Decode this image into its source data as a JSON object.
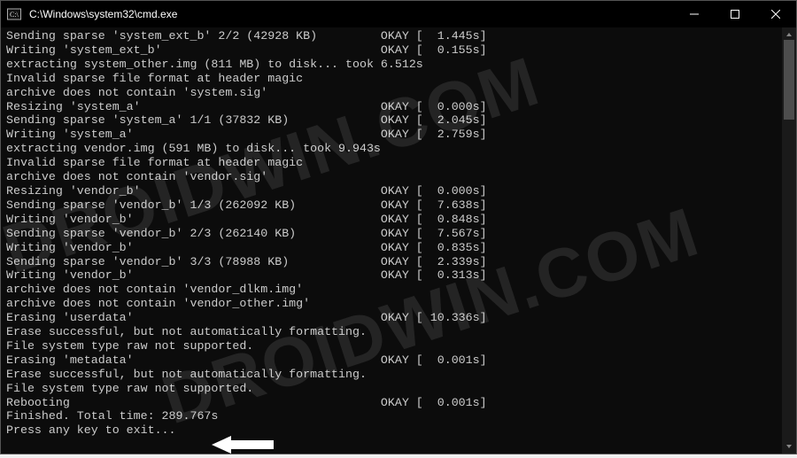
{
  "window": {
    "title": "C:\\Windows\\system32\\cmd.exe"
  },
  "watermark": "DROIDWIN.COM",
  "terminal": [
    {
      "text": "Sending sparse 'system_ext_b' 2/2 (42928 KB)",
      "status": "OKAY",
      "time": "1.445s"
    },
    {
      "text": "Writing 'system_ext_b'",
      "status": "OKAY",
      "time": "0.155s"
    },
    {
      "text": "extracting system_other.img (811 MB) to disk... took 6.512s"
    },
    {
      "text": "Invalid sparse file format at header magic"
    },
    {
      "text": "archive does not contain 'system.sig'"
    },
    {
      "text": "Resizing 'system_a'",
      "status": "OKAY",
      "time": "0.000s"
    },
    {
      "text": "Sending sparse 'system_a' 1/1 (37832 KB)",
      "status": "OKAY",
      "time": "2.045s"
    },
    {
      "text": "Writing 'system_a'",
      "status": "OKAY",
      "time": "2.759s"
    },
    {
      "text": "extracting vendor.img (591 MB) to disk... took 9.943s"
    },
    {
      "text": "Invalid sparse file format at header magic"
    },
    {
      "text": "archive does not contain 'vendor.sig'"
    },
    {
      "text": "Resizing 'vendor_b'",
      "status": "OKAY",
      "time": "0.000s"
    },
    {
      "text": "Sending sparse 'vendor_b' 1/3 (262092 KB)",
      "status": "OKAY",
      "time": "7.638s"
    },
    {
      "text": "Writing 'vendor_b'",
      "status": "OKAY",
      "time": "0.848s"
    },
    {
      "text": "Sending sparse 'vendor_b' 2/3 (262140 KB)",
      "status": "OKAY",
      "time": "7.567s"
    },
    {
      "text": "Writing 'vendor_b'",
      "status": "OKAY",
      "time": "0.835s"
    },
    {
      "text": "Sending sparse 'vendor_b' 3/3 (78988 KB)",
      "status": "OKAY",
      "time": "2.339s"
    },
    {
      "text": "Writing 'vendor_b'",
      "status": "OKAY",
      "time": "0.313s"
    },
    {
      "text": "archive does not contain 'vendor_dlkm.img'"
    },
    {
      "text": "archive does not contain 'vendor_other.img'"
    },
    {
      "text": "Erasing 'userdata'",
      "status": "OKAY",
      "time": "10.336s"
    },
    {
      "text": "Erase successful, but not automatically formatting."
    },
    {
      "text": "File system type raw not supported."
    },
    {
      "text": "Erasing 'metadata'",
      "status": "OKAY",
      "time": "0.001s"
    },
    {
      "text": "Erase successful, but not automatically formatting."
    },
    {
      "text": "File system type raw not supported."
    },
    {
      "text": "Rebooting",
      "status": "OKAY",
      "time": "0.001s"
    },
    {
      "text": "Finished. Total time: 289.767s"
    },
    {
      "text": "Press any key to exit..."
    }
  ],
  "layout": {
    "leftCol": 53,
    "timeCol": 7
  }
}
